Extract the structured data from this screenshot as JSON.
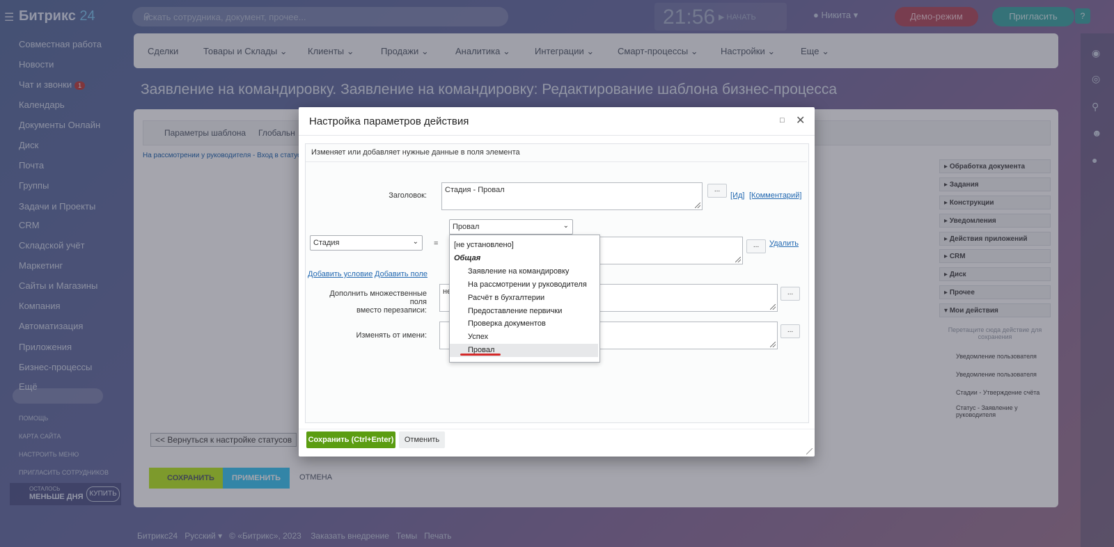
{
  "header": {
    "logo_text": "Битрикс",
    "logo_num": "24",
    "search_placeholder": "искать сотрудника, документ, прочее...",
    "clock": "21:56",
    "clock_action": "НАЧАТЬ",
    "user": "Никита",
    "demo": "Демо-режим",
    "invite": "Пригласить",
    "help": "?"
  },
  "leftmenu": {
    "items": [
      "Совместная работа",
      "Новости",
      "Чат и звонки",
      "Календарь",
      "Документы Онлайн",
      "Диск",
      "Почта",
      "Группы",
      "Задачи и Проекты",
      "CRM",
      "Складской учёт",
      "Маркетинг",
      "Сайты и Магазины",
      "Компания",
      "Автоматизация",
      "Приложения",
      "Бизнес-процессы",
      "Ещё"
    ],
    "chat_badge": "1",
    "small": [
      "ПОМОЩЬ",
      "КАРТА САЙТА",
      "НАСТРОИТЬ МЕНЮ",
      "ПРИГЛАСИТЬ СОТРУДНИКОВ"
    ],
    "promo_top": "ОСТАЛОСЬ",
    "promo_main": "МЕНЬШЕ ДНЯ",
    "promo_button": "КУПИТЬ"
  },
  "topnav": [
    "Сделки",
    "Товары и Склады",
    "Клиенты",
    "Продажи",
    "Аналитика",
    "Интеграции",
    "Смарт-процессы",
    "Настройки",
    "Еще"
  ],
  "page_title": "Заявление на командировку. Заявление на командировку: Редактирование шаблона бизнес-процесса",
  "tabs": [
    "Параметры шаблона",
    "Глобальн"
  ],
  "breadcrumb": "На рассмотрении у руководителя - Вход в статус",
  "sidebar": {
    "heads": [
      "Обработка документа",
      "Задания",
      "Конструкции",
      "Уведомления",
      "Действия приложений",
      "CRM",
      "Диск",
      "Прочее",
      "Мои действия"
    ],
    "drag_note": "Перетащите сюда действие для сохранения",
    "actions": [
      "Уведомление пользователя",
      "Уведомление пользователя",
      "Стадии - Утверждение счёта",
      "Статус - Заявление у руководителя"
    ]
  },
  "bottom": {
    "back": "<< Вернуться к настройке статусов",
    "save": "СОХРАНИТЬ",
    "apply": "ПРИМЕНИТЬ",
    "cancel": "ОТМЕНА"
  },
  "footer": {
    "brand": "Битрикс24",
    "lang": "Русский",
    "copyright": "© «Битрикс», 2023",
    "order": "Заказать внедрение",
    "themes": "Темы",
    "print": "Печать"
  },
  "modal": {
    "title": "Настройка параметров действия",
    "description": "Изменяет или добавляет нужные данные в поля элемента",
    "title_label": "Заголовок:",
    "title_value": "Стадия - Провал",
    "dots": "...",
    "link_id": "[Ид]",
    "link_comment": "[Комментарий]",
    "field_select": "Стадия",
    "equals": "=",
    "value_select": "Провал",
    "delete": "Удалить",
    "add_condition": "Добавить условие",
    "add_field": "Добавить поле",
    "multi_label_1": "Дополнить множественные поля",
    "multi_label_2": "вместо перезаписи:",
    "multi_value": "не",
    "from_label": "Изменять от имени:",
    "save": "Сохранить (Ctrl+Enter)",
    "cancel": "Отменить"
  },
  "dropdown": {
    "not_set": "[не установлено]",
    "group": "Общая",
    "options": [
      "Заявление на командировку",
      "На рассмотрении у руководителя",
      "Расчёт в бухгалтерии",
      "Предоставление первички",
      "Проверка документов",
      "Успех",
      "Провал"
    ],
    "selected": "Провал"
  }
}
